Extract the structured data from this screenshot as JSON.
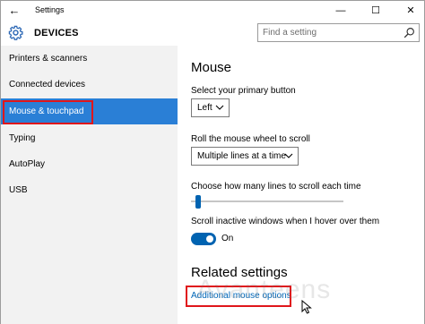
{
  "titlebar": {
    "title": "Settings",
    "back_icon": "←",
    "minimize_icon": "—",
    "maximize_icon": "☐",
    "close_icon": "✕"
  },
  "header": {
    "section": "DEVICES",
    "search_placeholder": "Find a setting"
  },
  "sidebar": {
    "items": [
      {
        "label": "Printers & scanners",
        "selected": false
      },
      {
        "label": "Connected devices",
        "selected": false
      },
      {
        "label": "Mouse & touchpad",
        "selected": true
      },
      {
        "label": "Typing",
        "selected": false
      },
      {
        "label": "AutoPlay",
        "selected": false
      },
      {
        "label": "USB",
        "selected": false
      }
    ]
  },
  "main": {
    "title": "Mouse",
    "primary_button": {
      "label": "Select your primary button",
      "value": "Left"
    },
    "scroll_wheel": {
      "label": "Roll the mouse wheel to scroll",
      "value": "Multiple lines at a time"
    },
    "lines_to_scroll": {
      "label": "Choose how many lines to scroll each time",
      "level": 0.03
    },
    "scroll_inactive": {
      "label": "Scroll inactive windows when I hover over them",
      "state": "On"
    },
    "related_title": "Related settings",
    "related_link": "Additional mouse options"
  },
  "colors": {
    "accent": "#0063b1",
    "selected_nav": "#2a7fd6",
    "annotation_red": "#e0161b",
    "link": "#0067b8"
  },
  "watermark": "Avanteens"
}
